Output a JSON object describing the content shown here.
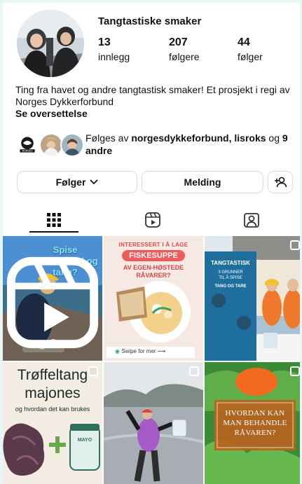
{
  "profile": {
    "username": "Tangtastiske smaker",
    "stats": [
      {
        "value": "13",
        "label": "innlegg"
      },
      {
        "value": "207",
        "label": "følgere"
      },
      {
        "value": "44",
        "label": "følger"
      }
    ],
    "bio": "Ting fra havet og andre tangtastisk smaker! Et prosjekt i regi av Norges Dykkerforbund",
    "translate_link": "Se oversettelse",
    "followed_by_prefix": "Følges av ",
    "followed_by_names": "norgesdykkeforbund, lisroks",
    "followed_by_and": " og ",
    "followed_by_others": "9 andre",
    "mini_logo_text": "NORGES"
  },
  "actions": {
    "following_label": "Følger",
    "message_label": "Melding"
  },
  "tabs": [
    "grid-icon",
    "reels-icon",
    "tagged-icon"
  ],
  "posts": [
    {
      "lines": [
        "Spise",
        "strandsnegl og",
        "tang?"
      ],
      "color": "#7ee6ff"
    },
    {
      "banner": "INTERESSERT I Å LAGE",
      "title": "FISKESUPPE",
      "subtitle_lines": [
        "AV EGEN-HØSTEDE",
        "RÅVARER?"
      ],
      "cta": "Swipe for mer",
      "accent": "#ef5c5c"
    },
    {
      "poster_title": "TANGTASTISK",
      "poster_sub_lines": [
        "3 GRUNNER",
        "TIL Å SPISE"
      ],
      "poster_sub2": "TANG OG TARE"
    },
    {
      "lines": [
        "Trøffeltang",
        "majones"
      ],
      "caption": "og hvordan det kan brukes",
      "jar_label": "MAYO"
    },
    {},
    {
      "lines": [
        "HVORDAN KAN",
        "MAN BEHANDLE",
        "RÅVAREN?"
      ]
    }
  ]
}
